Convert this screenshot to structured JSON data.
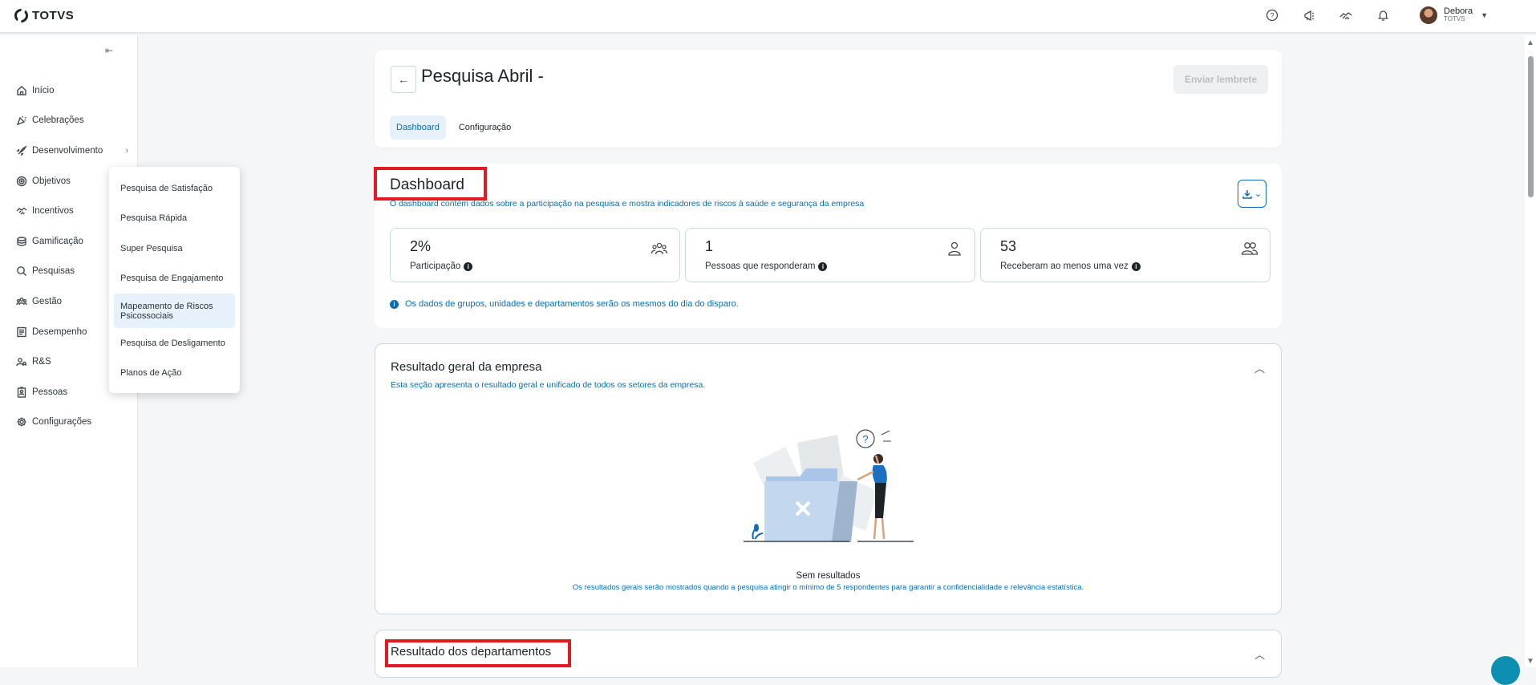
{
  "brand": {
    "name": "TOTVS"
  },
  "topbar": {
    "icons": [
      "help-icon",
      "megaphone-icon",
      "handshake-icon",
      "bell-icon"
    ],
    "user": {
      "name": "Debora",
      "company": "TOTVS"
    }
  },
  "sidebar": {
    "collapse_icon": "collapse-icon",
    "items": [
      {
        "label": "Início",
        "icon": "home-icon"
      },
      {
        "label": "Celebrações",
        "icon": "party-icon"
      },
      {
        "label": "Desenvolvimento",
        "icon": "rocket-icon",
        "chevron": "›"
      },
      {
        "label": "Objetivos",
        "icon": "target-icon"
      },
      {
        "label": "Incentivos",
        "icon": "handshake-icon"
      },
      {
        "label": "Gamificação",
        "icon": "coins-icon"
      },
      {
        "label": "Pesquisas",
        "icon": "search-icon"
      },
      {
        "label": "Gestão",
        "icon": "team-icon"
      },
      {
        "label": "Desempenho",
        "icon": "report-icon"
      },
      {
        "label": "R&S",
        "icon": "users-search-icon"
      },
      {
        "label": "Pessoas",
        "icon": "badge-icon"
      },
      {
        "label": "Configurações",
        "icon": "gear-icon"
      }
    ]
  },
  "submenu": {
    "items": [
      {
        "label": "Pesquisa de Satisfação"
      },
      {
        "label": "Pesquisa Rápida"
      },
      {
        "label": "Super Pesquisa"
      },
      {
        "label": "Pesquisa de Engajamento"
      },
      {
        "label": "Mapeamento de Riscos Psicossociais",
        "active": true
      },
      {
        "label": "Pesquisa de Desligamento"
      },
      {
        "label": "Planos de Ação"
      }
    ]
  },
  "header": {
    "back_icon": "←",
    "title": "Pesquisa Abril -",
    "remind_button": "Enviar lembrete",
    "tabs": [
      {
        "label": "Dashboard",
        "active": true
      },
      {
        "label": "Configuração",
        "active": false
      }
    ]
  },
  "dashboard": {
    "title": "Dashboard",
    "description": "O dashboard contém dados sobre a participação na pesquisa e mostra indicadores de riscos à saúde e segurança da empresa",
    "download_icon": "download-icon",
    "stats": [
      {
        "value": "2%",
        "label": "Participação",
        "icon": "group-icon"
      },
      {
        "value": "1",
        "label": "Pessoas que responderam",
        "icon": "person-icon"
      },
      {
        "value": "53",
        "label": "Receberam ao menos uma vez",
        "icon": "users-icon"
      }
    ],
    "note": "Os dados de grupos, unidades e departamentos serão os mesmos do dia do disparo."
  },
  "company_result": {
    "title": "Resultado geral da empresa",
    "description": "Esta seção apresenta o resultado geral e unificado de todos os setores da empresa.",
    "empty_title": "Sem resultados",
    "empty_description": "Os resultados gerais serão mostrados quando a pesquisa atingir o mínimo de 5 respondentes para garantir a confidencialidade e relevância estatística."
  },
  "departments_result": {
    "title": "Resultado dos departamentos"
  },
  "colors": {
    "accent": "#0c6cb2",
    "highlight_box": "#e21b23",
    "active_bg": "#e6f1fb"
  }
}
